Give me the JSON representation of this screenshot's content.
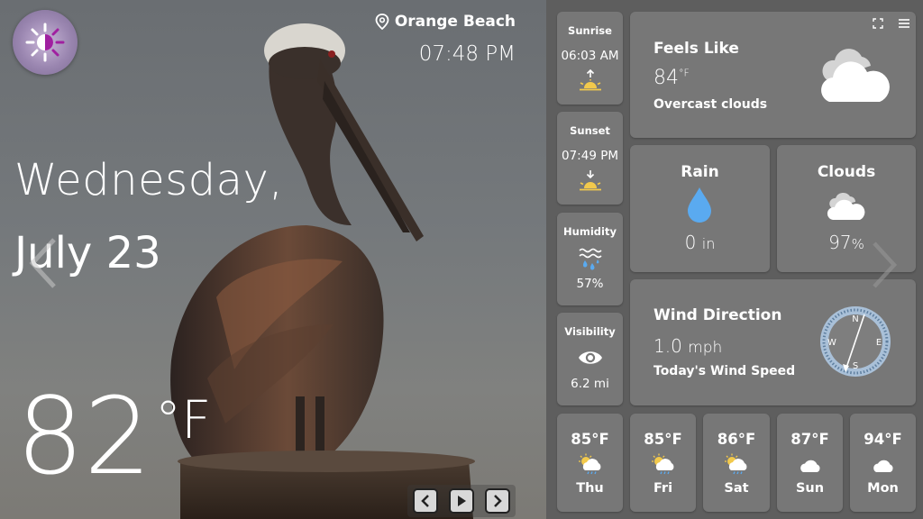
{
  "header": {
    "location": "Orange Beach",
    "time": "07:48 PM",
    "location_icon": "map-pin-icon",
    "logo_icon": "sun-snowflake-icon"
  },
  "date": {
    "weekday": "Wednesday,",
    "month_day": "July 23"
  },
  "current": {
    "temperature": "82",
    "unit": "°F"
  },
  "details": {
    "sunrise": {
      "label": "Sunrise",
      "value": "06:03 AM",
      "icon": "sunrise-icon"
    },
    "sunset": {
      "label": "Sunset",
      "value": "07:49 PM",
      "icon": "sunset-icon"
    },
    "humidity": {
      "label": "Humidity",
      "value": "57%",
      "icon": "humidity-icon"
    },
    "visibility": {
      "label": "Visibility",
      "value": "6.2 mi",
      "icon": "eye-icon"
    }
  },
  "feels_like": {
    "title": "Feels Like",
    "value": "84",
    "unit": "°F",
    "condition": "Overcast clouds",
    "icon": "cloud-icon"
  },
  "rain": {
    "title": "Rain",
    "value": "0",
    "unit": "in",
    "icon": "raindrop-icon"
  },
  "clouds": {
    "title": "Clouds",
    "value": "97",
    "unit": "%",
    "icon": "clouds-icon"
  },
  "wind": {
    "title": "Wind Direction",
    "value": "1.0",
    "unit": "mph",
    "caption": "Today's Wind Speed",
    "compass": [
      "N",
      "E",
      "S",
      "W"
    ],
    "icon": "compass-icon"
  },
  "forecast": [
    {
      "temp": "85°F",
      "day": "Thu",
      "icon": "sun-rain-cloud-icon"
    },
    {
      "temp": "85°F",
      "day": "Fri",
      "icon": "sun-rain-cloud-icon"
    },
    {
      "temp": "86°F",
      "day": "Sat",
      "icon": "sun-rain-cloud-icon"
    },
    {
      "temp": "87°F",
      "day": "Sun",
      "icon": "cloud-icon"
    },
    {
      "temp": "94°F",
      "day": "Mon",
      "icon": "cloud-icon"
    }
  ],
  "colors": {
    "panel_bg": "#5e5e5e",
    "card_bg": "#777777",
    "accent_blue": "#5aaaf0",
    "sun_yellow": "#f2c94c"
  }
}
